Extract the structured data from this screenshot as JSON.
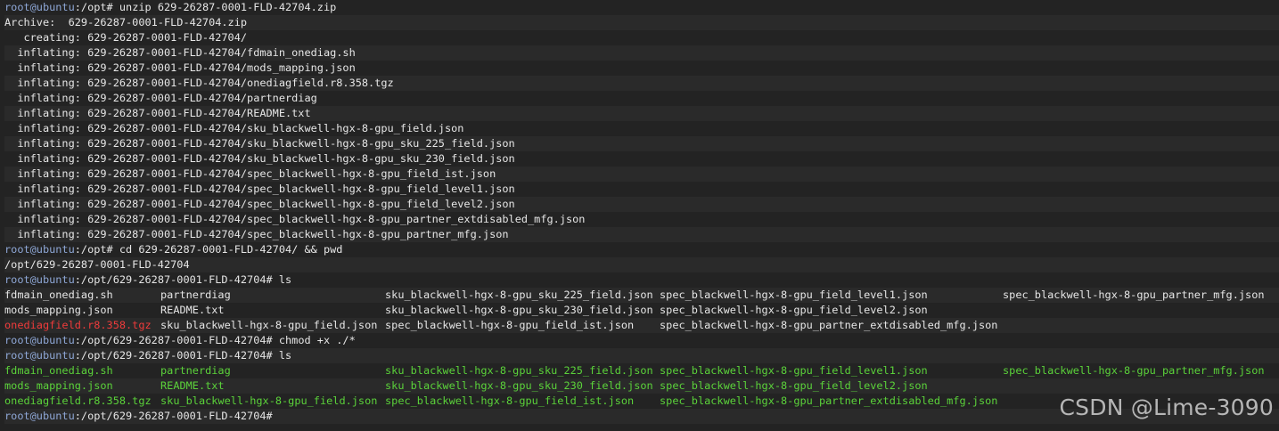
{
  "colors": {
    "background": "#232323",
    "prompt_user": "#8ea7d6",
    "text": "#e6e6e6",
    "archive_red": "#ef3b3b",
    "executable_green": "#5bd23a"
  },
  "prompt_user": "root@ubuntu",
  "lines": {
    "l0": {
      "path": ":/opt# ",
      "cmd": "unzip 629-26287-0001-FLD-42704.zip"
    },
    "l1": "Archive:  629-26287-0001-FLD-42704.zip",
    "l2": "   creating: 629-26287-0001-FLD-42704/",
    "l3": "  inflating: 629-26287-0001-FLD-42704/fdmain_onediag.sh",
    "l4": "  inflating: 629-26287-0001-FLD-42704/mods_mapping.json",
    "l5": "  inflating: 629-26287-0001-FLD-42704/onediagfield.r8.358.tgz",
    "l6": "  inflating: 629-26287-0001-FLD-42704/partnerdiag",
    "l7": "  inflating: 629-26287-0001-FLD-42704/README.txt",
    "l8": "  inflating: 629-26287-0001-FLD-42704/sku_blackwell-hgx-8-gpu_field.json",
    "l9": "  inflating: 629-26287-0001-FLD-42704/sku_blackwell-hgx-8-gpu_sku_225_field.json",
    "l10": "  inflating: 629-26287-0001-FLD-42704/sku_blackwell-hgx-8-gpu_sku_230_field.json",
    "l11": "  inflating: 629-26287-0001-FLD-42704/spec_blackwell-hgx-8-gpu_field_ist.json",
    "l12": "  inflating: 629-26287-0001-FLD-42704/spec_blackwell-hgx-8-gpu_field_level1.json",
    "l13": "  inflating: 629-26287-0001-FLD-42704/spec_blackwell-hgx-8-gpu_field_level2.json",
    "l14": "  inflating: 629-26287-0001-FLD-42704/spec_blackwell-hgx-8-gpu_partner_extdisabled_mfg.json",
    "l15": "  inflating: 629-26287-0001-FLD-42704/spec_blackwell-hgx-8-gpu_partner_mfg.json",
    "l16": {
      "path": ":/opt# ",
      "cmd": "cd 629-26287-0001-FLD-42704/ && pwd"
    },
    "l17": "/opt/629-26287-0001-FLD-42704",
    "l18": {
      "path": ":/opt/629-26287-0001-FLD-42704# ",
      "cmd": "ls"
    },
    "l22": {
      "path": ":/opt/629-26287-0001-FLD-42704# ",
      "cmd": "chmod +x ./*"
    },
    "l23": {
      "path": ":/opt/629-26287-0001-FLD-42704# ",
      "cmd": "ls"
    },
    "l27": {
      "path": ":/opt/629-26287-0001-FLD-42704# ",
      "cmd": ""
    }
  },
  "ls1": {
    "r0": [
      "fdmain_onediag.sh",
      "partnerdiag",
      "sku_blackwell-hgx-8-gpu_sku_225_field.json",
      "spec_blackwell-hgx-8-gpu_field_level1.json",
      "spec_blackwell-hgx-8-gpu_partner_mfg.json"
    ],
    "r1": [
      "mods_mapping.json",
      "README.txt",
      "sku_blackwell-hgx-8-gpu_sku_230_field.json",
      "spec_blackwell-hgx-8-gpu_field_level2.json"
    ],
    "r2": [
      "onediagfield.r8.358.tgz",
      "sku_blackwell-hgx-8-gpu_field.json",
      "spec_blackwell-hgx-8-gpu_field_ist.json",
      "spec_blackwell-hgx-8-gpu_partner_extdisabled_mfg.json"
    ]
  },
  "ls2": {
    "r0": [
      "fdmain_onediag.sh",
      "partnerdiag",
      "sku_blackwell-hgx-8-gpu_sku_225_field.json",
      "spec_blackwell-hgx-8-gpu_field_level1.json",
      "spec_blackwell-hgx-8-gpu_partner_mfg.json"
    ],
    "r1": [
      "mods_mapping.json",
      "README.txt",
      "sku_blackwell-hgx-8-gpu_sku_230_field.json",
      "spec_blackwell-hgx-8-gpu_field_level2.json"
    ],
    "r2": [
      "onediagfield.r8.358.tgz",
      "sku_blackwell-hgx-8-gpu_field.json",
      "spec_blackwell-hgx-8-gpu_field_ist.json",
      "spec_blackwell-hgx-8-gpu_partner_extdisabled_mfg.json"
    ]
  },
  "watermark": "CSDN @Lime-3090"
}
